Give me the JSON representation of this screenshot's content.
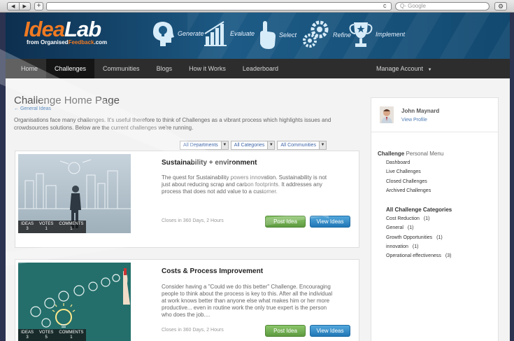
{
  "browser": {
    "back": "◀",
    "forward": "▶",
    "new_tab": "+",
    "reload": "c",
    "search_placeholder": "Q- Google",
    "gear": "⚙"
  },
  "logo": {
    "idea": "Idea",
    "lab": "Lab",
    "sub_prefix": "from Organised",
    "sub_mid": "Feedback",
    "sub_suffix": ".com"
  },
  "steps": [
    {
      "label": "Generate",
      "icon": "head-bulb-icon"
    },
    {
      "label": "Evaluate",
      "icon": "bar-chart-icon"
    },
    {
      "label": "Select",
      "icon": "hand-pointer-icon"
    },
    {
      "label": "Refine",
      "icon": "gears-icon"
    },
    {
      "label": "Implement",
      "icon": "trophy-icon"
    }
  ],
  "nav": {
    "items": [
      "Home",
      "Challenges",
      "Communities",
      "Blogs",
      "How it Works",
      "Leaderboard"
    ],
    "active": "Challenges",
    "account": "Manage Account"
  },
  "page": {
    "title": "Challenge Home Page",
    "back_link": "← General Ideas",
    "intro": "Organisations face many challenges. It's useful therefore to think of Challenges as a vibrant process which highlights issues and crowdsources solutions. Below are the current challenges we're running."
  },
  "filters": [
    {
      "label": "All Departments"
    },
    {
      "label": "All Categories"
    },
    {
      "label": "All Communities"
    }
  ],
  "challenges": [
    {
      "title": "Sustainability + environment",
      "desc": "The quest for Sustainability powers innovation. Sustainability is not just about reducing scrap and carbon footprints. It addresses any process that does not add value to a customer.",
      "closes": "Closes in 360 Days, 2 Hours",
      "ideas_label": "IDEAS",
      "ideas": "3",
      "votes_label": "VOTES",
      "votes": "1",
      "comments_label": "COMMENTS",
      "comments": "1",
      "post_label": "Post Idea",
      "view_label": "View Ideas"
    },
    {
      "title": "Costs & Process Improvement",
      "desc": "Consider having a \"Could we do this better\" Challenge. Encouraging people to think about the process is key to this. After all the individual at work knows better than anyone else what makes him or her more productive... even in routine work the only true expert is the person who does the job....",
      "closes": "Closes in 360 Days, 2 Hours",
      "ideas_label": "IDEAS",
      "ideas": "3",
      "votes_label": "VOTES",
      "votes": "5",
      "comments_label": "COMMENTS",
      "comments": "1",
      "post_label": "Post Idea",
      "view_label": "View Ideas"
    }
  ],
  "sidebar": {
    "user_name": "John Maynard",
    "view_profile": "View Profile",
    "menu_title_bold": "Challenge",
    "menu_title_light": " Personal Menu",
    "menu_items": [
      "Dashboard",
      "Live Challenges",
      "Closed Challenges",
      "Archived Challenges"
    ],
    "categories_title": "All Challenge Categories",
    "categories": [
      {
        "name": "Cost Reduction",
        "count": "(1)"
      },
      {
        "name": "General",
        "count": "(1)"
      },
      {
        "name": "Growth Opportunities",
        "count": "(1)"
      },
      {
        "name": "innovation",
        "count": "(1)"
      },
      {
        "name": "Operational effectiveness",
        "count": "(3)"
      }
    ]
  }
}
